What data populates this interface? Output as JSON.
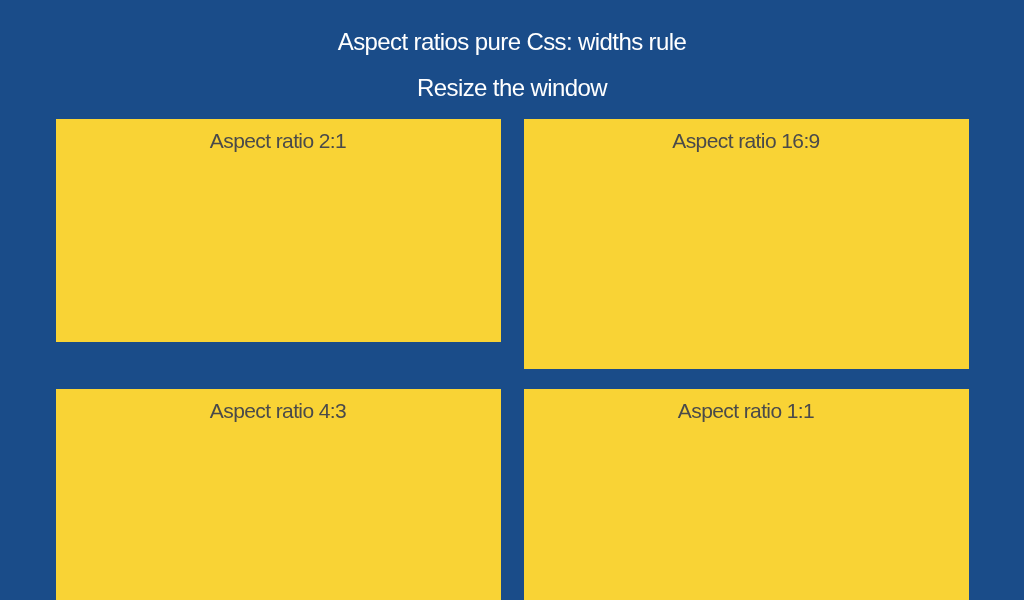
{
  "header": {
    "title": "Aspect ratios pure Css: widths rule",
    "subtitle": "Resize the window"
  },
  "cards": [
    {
      "label": "Aspect ratio 2:1"
    },
    {
      "label": "Aspect ratio 16:9"
    },
    {
      "label": "Aspect ratio 4:3"
    },
    {
      "label": "Aspect ratio 1:1"
    }
  ]
}
